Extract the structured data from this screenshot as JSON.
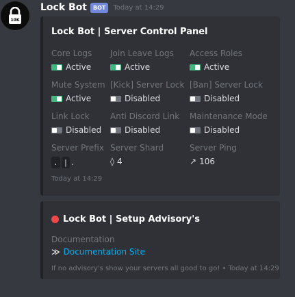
{
  "message": {
    "author": "Lock Bot",
    "bot_tag": "BOT",
    "timestamp": "Today at 14:29",
    "avatar_text": "10K"
  },
  "control_panel": {
    "title": "Lock Bot | Server Control Panel",
    "fields": [
      {
        "name": "Core Logs",
        "value": "Active",
        "state": "on"
      },
      {
        "name": "Join Leave Logs",
        "value": "Active",
        "state": "on"
      },
      {
        "name": "Access Roles",
        "value": "Active",
        "state": "on"
      },
      {
        "name": "Mute System",
        "value": "Active",
        "state": "on"
      },
      {
        "name": "[Kick] Server Lock",
        "value": "Disabled",
        "state": "off"
      },
      {
        "name": "[Ban] Server Lock",
        "value": "Disabled",
        "state": "off"
      },
      {
        "name": "Link Lock",
        "value": "Disabled",
        "state": "off"
      },
      {
        "name": "Anti Discord Link",
        "value": "Disabled",
        "state": "off"
      },
      {
        "name": "Maintenance Mode",
        "value": "Disabled",
        "state": "off"
      }
    ],
    "prefix": {
      "name": "Server Prefix",
      "code1": ".",
      "code2": "|",
      "tail": "."
    },
    "shard": {
      "name": "Server Shard",
      "icon": "diamond-icon",
      "value": "4"
    },
    "ping": {
      "name": "Server Ping",
      "icon": "ping-arrow-icon",
      "value": "106"
    },
    "footer": "Today at 14:29"
  },
  "advisory": {
    "title": "Lock Bot | Setup Advisory's",
    "field_name": "Documentation",
    "link_text": "Documentation Site",
    "footer": "If no advisory's show your servers all good to go!",
    "footer_sep": "•",
    "footer_time": "Today at 14:29"
  },
  "colors": {
    "active_toggle": "#43b581",
    "disabled_toggle": "#72767d",
    "link": "#00b0f4",
    "bot_tag": "#7289da",
    "advisory_dot": "#f04747"
  }
}
